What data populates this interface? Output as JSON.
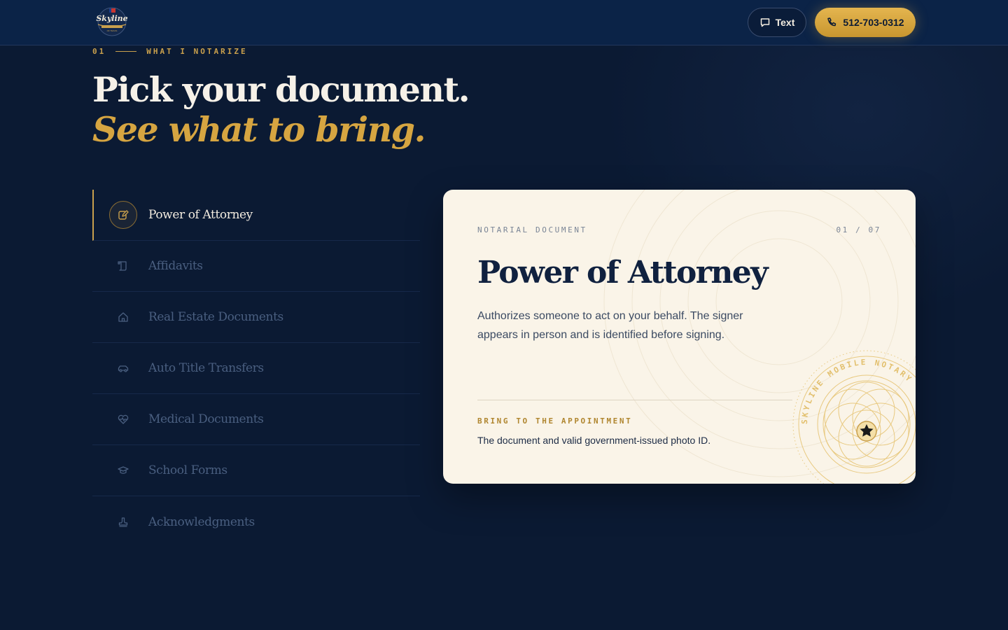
{
  "header": {
    "logo_alt": "Skyline Mobile Notary of Texas",
    "text_button": {
      "label": "Text",
      "icon": "chat-bubble-icon"
    },
    "phone_button": {
      "label": "512-703-0312",
      "icon": "phone-icon"
    }
  },
  "section": {
    "number": "01",
    "eyebrow": "WHAT I NOTARIZE",
    "headline": "Pick your document.",
    "headline_sub": "See what to bring."
  },
  "documents": [
    {
      "label": "Power of Attorney",
      "icon": "pen-square-icon",
      "active": true
    },
    {
      "label": "Affidavits",
      "icon": "scroll-icon",
      "active": false
    },
    {
      "label": "Real Estate Documents",
      "icon": "house-icon",
      "active": false
    },
    {
      "label": "Auto Title Transfers",
      "icon": "car-icon",
      "active": false
    },
    {
      "label": "Medical Documents",
      "icon": "heart-pulse-icon",
      "active": false
    },
    {
      "label": "School Forms",
      "icon": "graduation-cap-icon",
      "active": false
    },
    {
      "label": "Acknowledgments",
      "icon": "stamp-icon",
      "active": false
    }
  ],
  "card": {
    "tag": "NOTARIAL DOCUMENT",
    "count": "01 / 07",
    "title": "Power of Attorney",
    "description": "Authorizes someone to act on your behalf. The signer appears in person and is identified before signing.",
    "bring_label": "BRING TO THE APPOINTMENT",
    "bring_text": "The document and valid government-issued photo ID.",
    "seal_text": "SKYLINE MOBILE NOTARY"
  },
  "colors": {
    "background": "#0b1a33",
    "accent_gold": "#d6a541",
    "card_bg": "#faf4e8",
    "title_navy": "#10213f"
  }
}
